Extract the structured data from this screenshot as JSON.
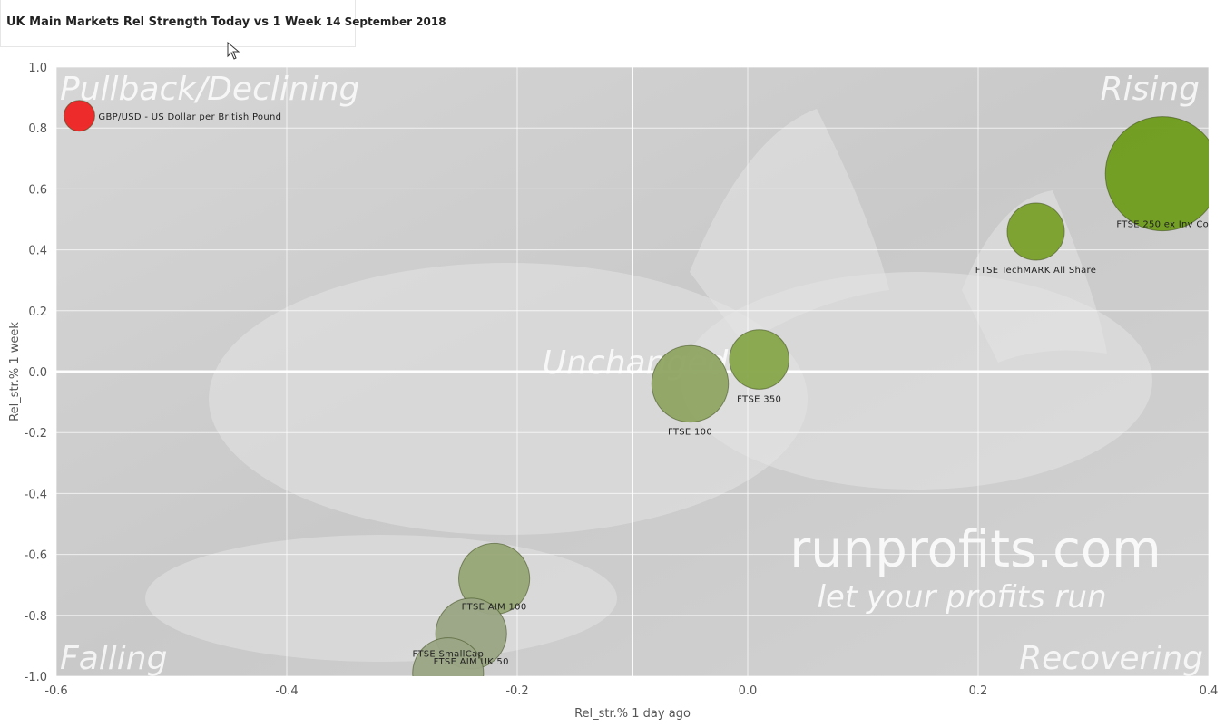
{
  "header": {
    "title": "UK Main Markets Rel Strength  Today vs 1 Week",
    "date": "14 September 2018"
  },
  "colors": {
    "positive": "#6e9c1a",
    "neutral": "#8fa562",
    "negative_faded": "#9aa585",
    "alert": "#ee2222",
    "plot_bg": "#cfcfcf",
    "grid": "#ffffff"
  },
  "chart_data": {
    "type": "scatter",
    "xlabel": "Rel_str.% 1 day ago",
    "ylabel": "Rel_str.% 1 week",
    "xlim": [
      -0.6,
      0.4
    ],
    "ylim": [
      -1.0,
      1.0
    ],
    "x_ticks": [
      "-0.6",
      "-0.4",
      "-0.2",
      "0.0",
      "0.2",
      "0.4"
    ],
    "y_ticks": [
      "1.0",
      "0.8",
      "0.6",
      "0.4",
      "0.2",
      "0.0",
      "-0.2",
      "-0.4",
      "-0.6",
      "-0.8",
      "-1.0"
    ],
    "grid": true,
    "quadrant_labels": {
      "top_left": "Pullback/Declining",
      "top_right": "Rising",
      "bottom_left": "Falling",
      "bottom_right": "Recovering",
      "center": "Unchanged"
    },
    "watermark": {
      "main": "runprofits.com",
      "sub": "let your profits run"
    },
    "points": [
      {
        "name": "GBP/USD - US Dollar per British Pound",
        "x": -0.58,
        "y": 0.84,
        "size": 0.27,
        "color": "#ee2222"
      },
      {
        "name": "FTSE 250 ex Inv Co",
        "x": 0.36,
        "y": 0.65,
        "size": 1.0,
        "color": "#6e9c1a"
      },
      {
        "name": "FTSE TechMARK All Share",
        "x": 0.25,
        "y": 0.46,
        "size": 0.5,
        "color": "#7aa02a"
      },
      {
        "name": "FTSE 350",
        "x": 0.01,
        "y": 0.04,
        "size": 0.52,
        "color": "#86a548"
      },
      {
        "name": "FTSE 100",
        "x": -0.05,
        "y": -0.04,
        "size": 0.67,
        "color": "#8fa562"
      },
      {
        "name": "FTSE AIM 100",
        "x": -0.22,
        "y": -0.68,
        "size": 0.62,
        "color": "#97a675"
      },
      {
        "name": "FTSE AIM UK 50",
        "x": -0.24,
        "y": -0.86,
        "size": 0.62,
        "color": "#9aa585"
      },
      {
        "name": "FTSE SmallCap",
        "x": -0.26,
        "y": -0.99,
        "size": 0.62,
        "color": "#9aa585"
      }
    ]
  }
}
